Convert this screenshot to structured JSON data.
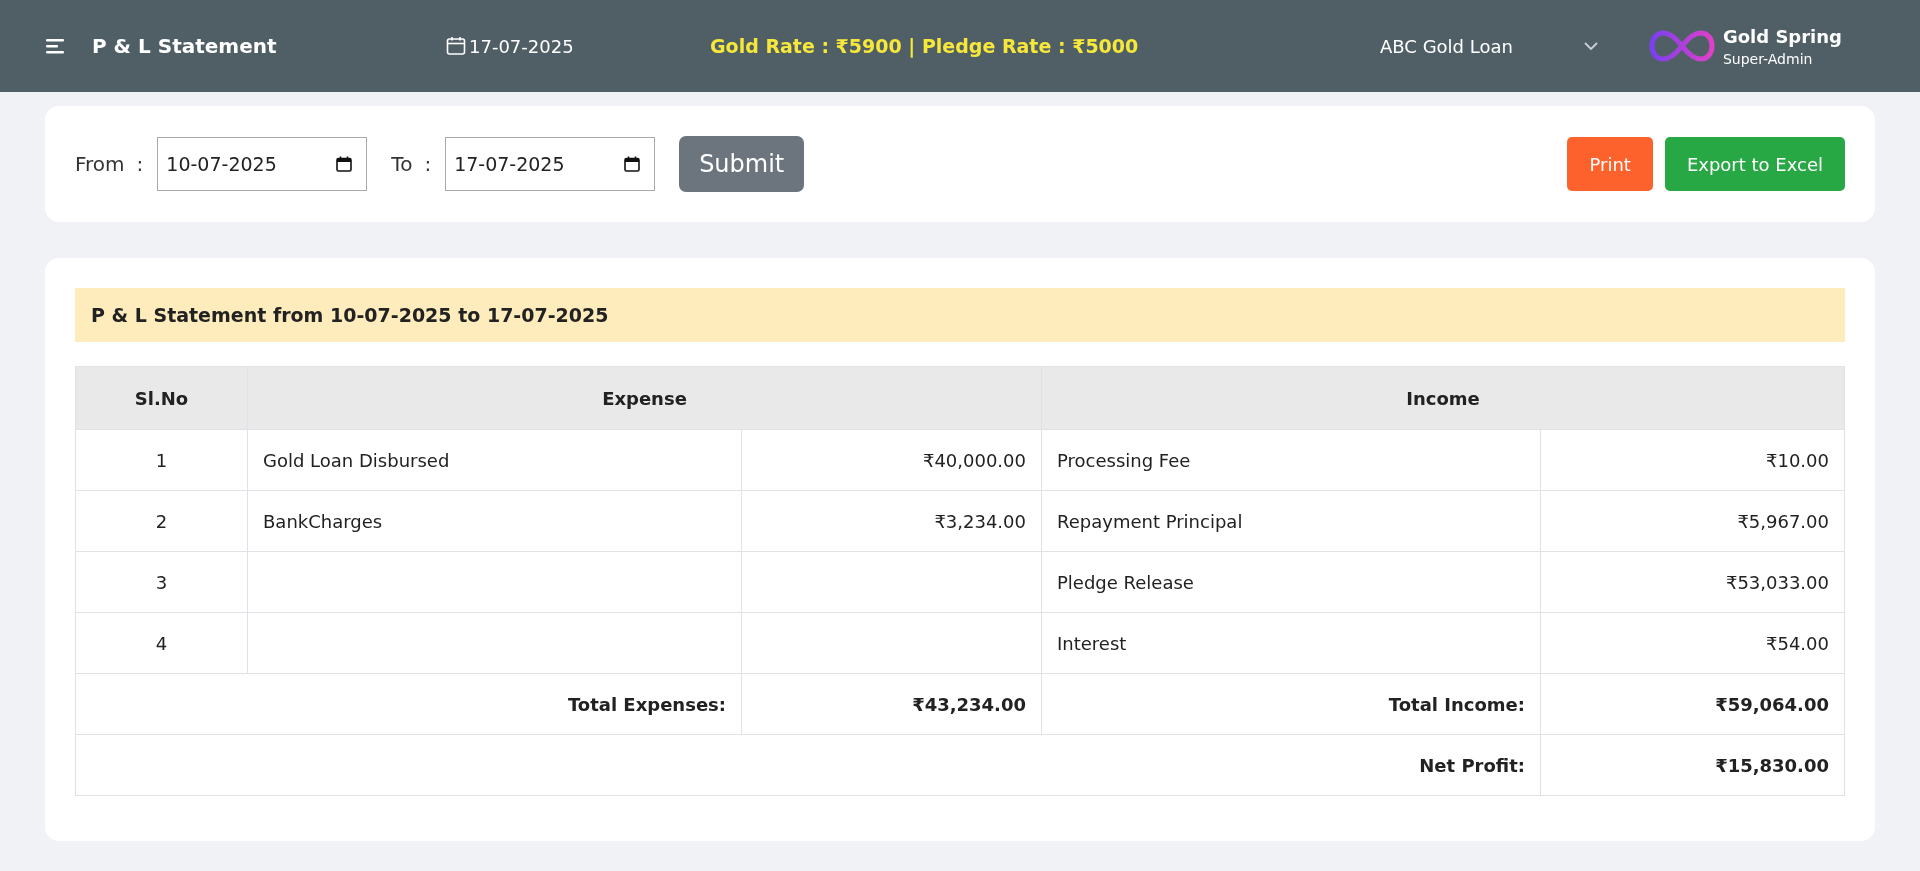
{
  "header": {
    "title": "P & L Statement",
    "date": "17-07-2025",
    "rates": "Gold Rate : ₹5900 | Pledge Rate : ₹5000",
    "company": "ABC Gold Loan",
    "user_name": "Gold Spring",
    "user_role": "Super-Admin"
  },
  "filter": {
    "from_label": "From",
    "to_label": "To",
    "separator": ":",
    "from_date": "10-07-2025",
    "to_date": "17-07-2025",
    "submit": "Submit",
    "print": "Print",
    "export": "Export to Excel"
  },
  "report": {
    "title": "P & L Statement from 10-07-2025 to 17-07-2025",
    "columns": [
      "Sl.No",
      "Expense",
      "Income"
    ],
    "rows": [
      {
        "sl_no": "1",
        "expense": "Gold Loan Disbursed",
        "expense_amount": "₹40,000.00",
        "income": "Processing Fee",
        "income_amount": "₹10.00"
      },
      {
        "sl_no": "2",
        "expense": "BankCharges",
        "expense_amount": "₹3,234.00",
        "income": "Repayment Principal",
        "income_amount": "₹5,967.00"
      },
      {
        "sl_no": "3",
        "income": "Pledge Release",
        "income_amount": "₹53,033.00"
      },
      {
        "sl_no": "4",
        "income": "Interest",
        "income_amount": "₹54.00"
      }
    ],
    "total_expenses_label": "Total Expenses:",
    "total_expenses": "₹43,234.00",
    "total_income_label": "Total Income:",
    "total_income": "₹59,064.00",
    "net_profit_label": "Net Profit:",
    "net_profit": "₹15,830.00"
  }
}
